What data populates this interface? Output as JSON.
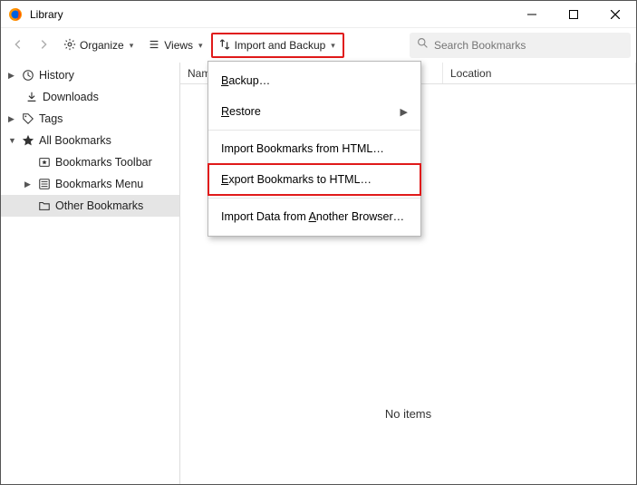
{
  "window": {
    "title": "Library"
  },
  "toolbar": {
    "organize_label": "Organize",
    "views_label": "Views",
    "import_backup_label": "Import and Backup"
  },
  "search": {
    "placeholder": "Search Bookmarks"
  },
  "sidebar": {
    "history": "History",
    "downloads": "Downloads",
    "tags": "Tags",
    "all_bookmarks": "All Bookmarks",
    "bookmarks_toolbar": "Bookmarks Toolbar",
    "bookmarks_menu": "Bookmarks Menu",
    "other_bookmarks": "Other Bookmarks"
  },
  "columns": {
    "name": "Name",
    "location": "Location"
  },
  "content": {
    "no_items": "No items"
  },
  "menu": {
    "backup": "Backup…",
    "restore": "Restore",
    "import_html": "Import Bookmarks from HTML…",
    "export_html": "Export Bookmarks to HTML…",
    "import_other": "Import Data from Another Browser…",
    "accel": {
      "backup": "B",
      "restore": "R",
      "export": "E",
      "another": "A"
    }
  }
}
